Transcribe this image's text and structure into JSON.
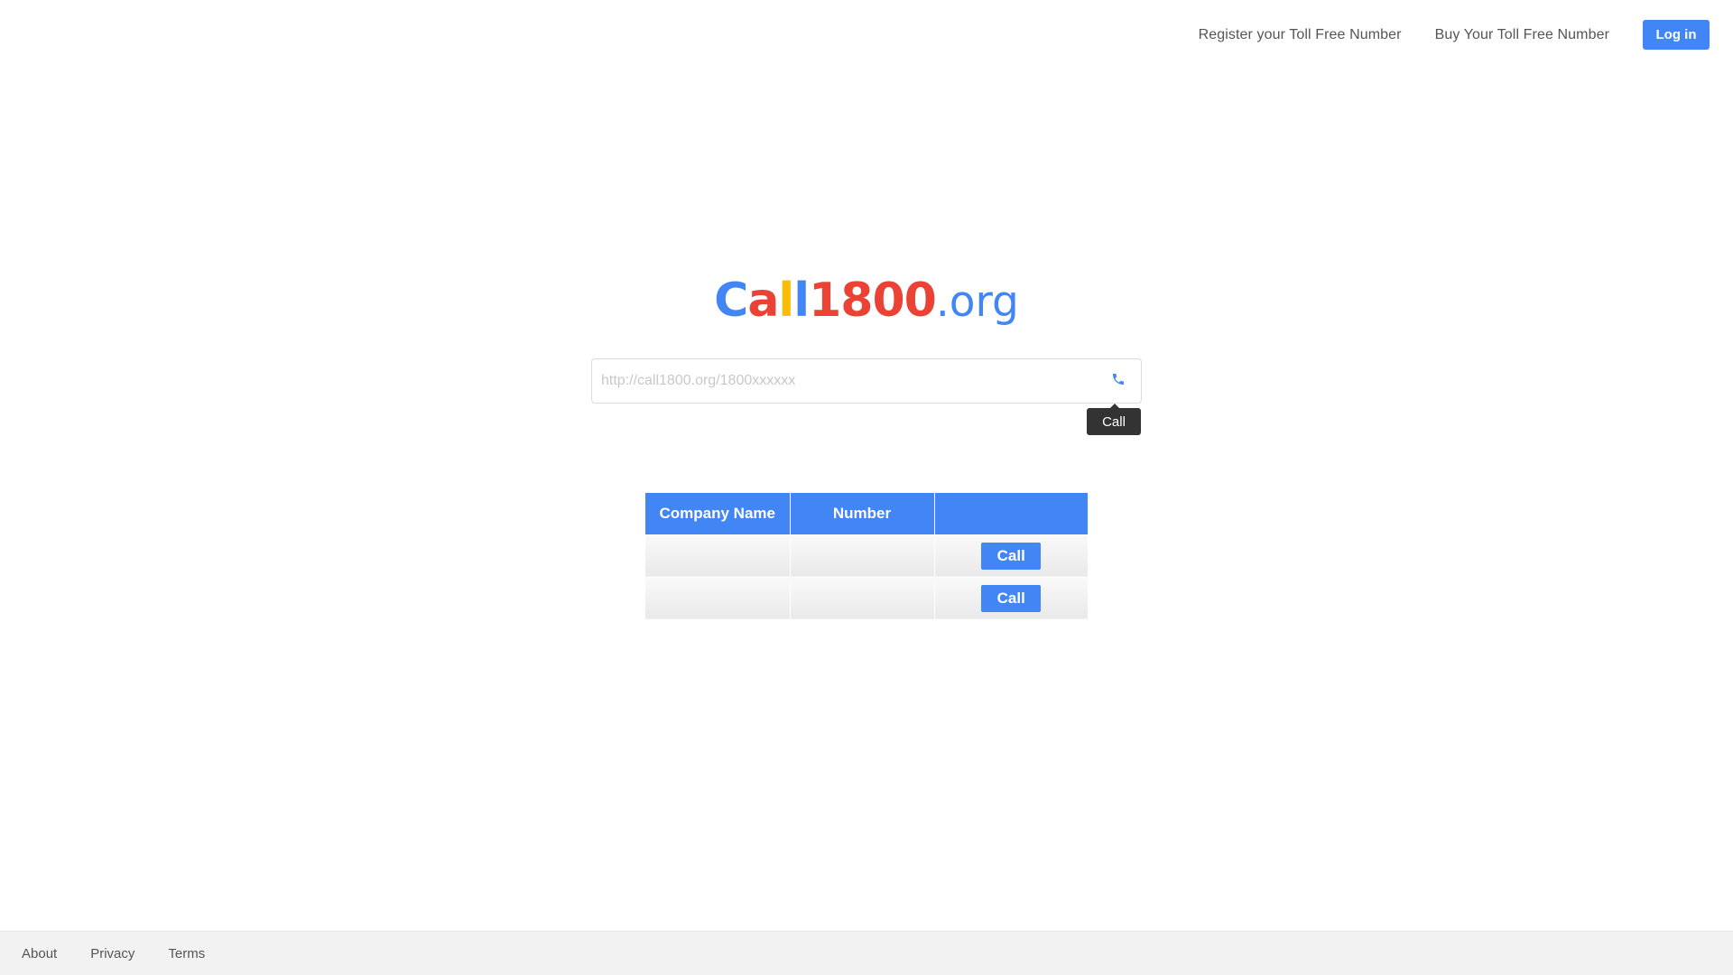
{
  "nav": {
    "register_label": "Register your Toll Free Number",
    "buy_label": "Buy Your Toll Free Number",
    "login_label": "Log in"
  },
  "logo": {
    "letters": [
      {
        "char": "C",
        "color": "#4285f4"
      },
      {
        "char": "a",
        "color": "#ea4335"
      },
      {
        "char": "l",
        "color": "#fbbc05"
      },
      {
        "char": "l",
        "color": "#4285f4"
      },
      {
        "char": "1800",
        "color": "#ea4335"
      }
    ],
    "tld": ".org",
    "tld_color": "#4285f4"
  },
  "search": {
    "placeholder": "http://call1800.org/1800xxxxxx",
    "value": "",
    "icon": "phone-icon",
    "tooltip": "Call"
  },
  "table": {
    "headers": [
      "Company Name",
      "Number",
      ""
    ],
    "rows": [
      {
        "company": "",
        "number": "",
        "action": "Call"
      },
      {
        "company": "",
        "number": "",
        "action": "Call"
      }
    ]
  },
  "footer": {
    "links": [
      "About",
      "Privacy",
      "Terms"
    ]
  },
  "colors": {
    "accent": "#4285f4",
    "tooltip_bg": "#333333",
    "footer_bg": "#f2f2f2"
  }
}
